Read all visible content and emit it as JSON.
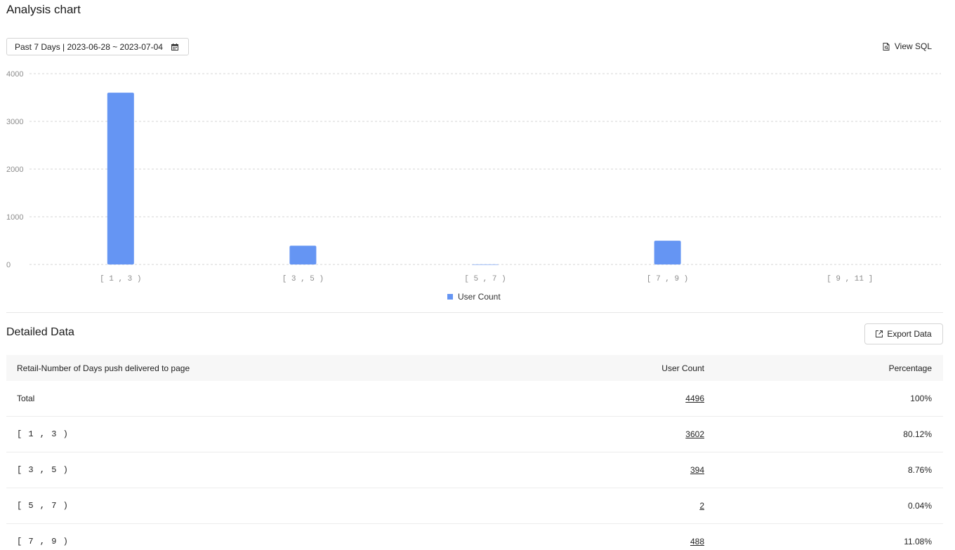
{
  "header": {
    "title": "Analysis chart"
  },
  "filters": {
    "date_range_label": "Past 7 Days | 2023-06-28 ~ 2023-07-04"
  },
  "actions": {
    "view_sql_label": "View SQL",
    "export_label": "Export Data"
  },
  "chart_data": {
    "type": "bar",
    "categories": [
      "[ 1 , 3 )",
      "[ 3 , 5 )",
      "[ 5 , 7 )",
      "[ 7 , 9 )",
      "[ 9 , 11 ]"
    ],
    "series": [
      {
        "name": "User Count",
        "values": [
          3602,
          394,
          2,
          498,
          0
        ],
        "color": "#6595f3"
      }
    ],
    "ylim": [
      0,
      4000
    ],
    "yticks": [
      0,
      1000,
      2000,
      3000,
      4000
    ],
    "grid": true,
    "legend": "bottom-center"
  },
  "detail": {
    "title": "Detailed Data",
    "columns": [
      "Retail-Number of Days push delivered to page",
      "User Count",
      "Percentage"
    ],
    "rows": [
      {
        "label": "Total",
        "count": "4496",
        "pct": "100%"
      },
      {
        "label": "[ 1 , 3 )",
        "count": "3602",
        "pct": "80.12%"
      },
      {
        "label": "[ 3 , 5 )",
        "count": "394",
        "pct": "8.76%"
      },
      {
        "label": "[ 5 , 7 )",
        "count": "2",
        "pct": "0.04%"
      },
      {
        "label": "[ 7 , 9 )",
        "count": "488",
        "pct": "11.08%"
      }
    ]
  },
  "icons": {
    "date_picker": "calendar-icon",
    "view_sql": "document-icon",
    "export": "export-icon"
  }
}
